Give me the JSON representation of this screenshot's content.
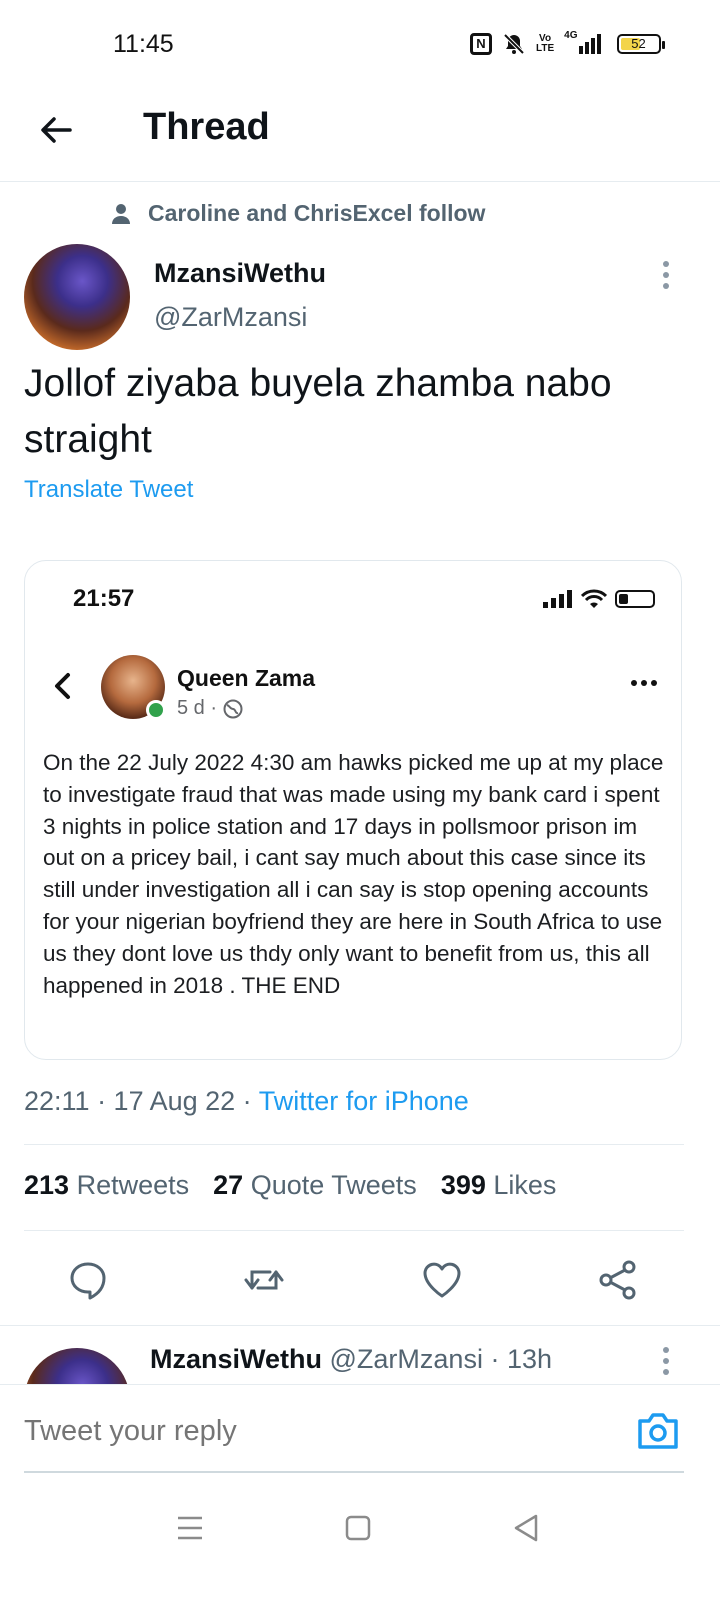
{
  "status_bar": {
    "time": "11:45",
    "nfc": "N",
    "volte": [
      "Vo",
      "LTE"
    ],
    "network": "4G",
    "battery": "52",
    "battery_level": 0.52,
    "battery_color": "#f3d44a"
  },
  "header": {
    "title": "Thread"
  },
  "tweet": {
    "social_context": "Caroline and ChrisExcel follow",
    "author_name": "MzansiWethu",
    "author_handle": "@ZarMzansi",
    "text": "Jollof ziyaba buyela zhamba nabo straight",
    "translate_label": "Translate Tweet",
    "timestamp": "22:11 · 17 Aug 22 · ",
    "source": "Twitter for iPhone",
    "stats": {
      "retweets_count": "213",
      "retweets_label": "Retweets",
      "quotes_count": "27",
      "quotes_label": "Quote Tweets",
      "likes_count": "399",
      "likes_label": "Likes"
    }
  },
  "embedded_post": {
    "time": "21:57",
    "name": "Queen Zama",
    "meta": "5 d ·",
    "body": "On the 22 July 2022 4:30 am hawks picked me up at my place to investigate fraud that was made using my bank card i spent 3 nights in police station and 17 days in pollsmoor prison im out on a pricey bail, i cant say much about this case since its still under investigation all i can say is stop opening accounts for your nigerian boyfriend they are here in South Africa to use us they dont love us thdy only want to benefit from us, this all happened in 2018 . THE END"
  },
  "reply": {
    "name": "MzansiWethu",
    "handle_time": " @ZarMzansi · 13h"
  },
  "composer": {
    "placeholder": "Tweet your reply"
  },
  "colors": {
    "accent": "#1d9bf0",
    "secondary_text": "#536471",
    "online": "#31a24c"
  }
}
